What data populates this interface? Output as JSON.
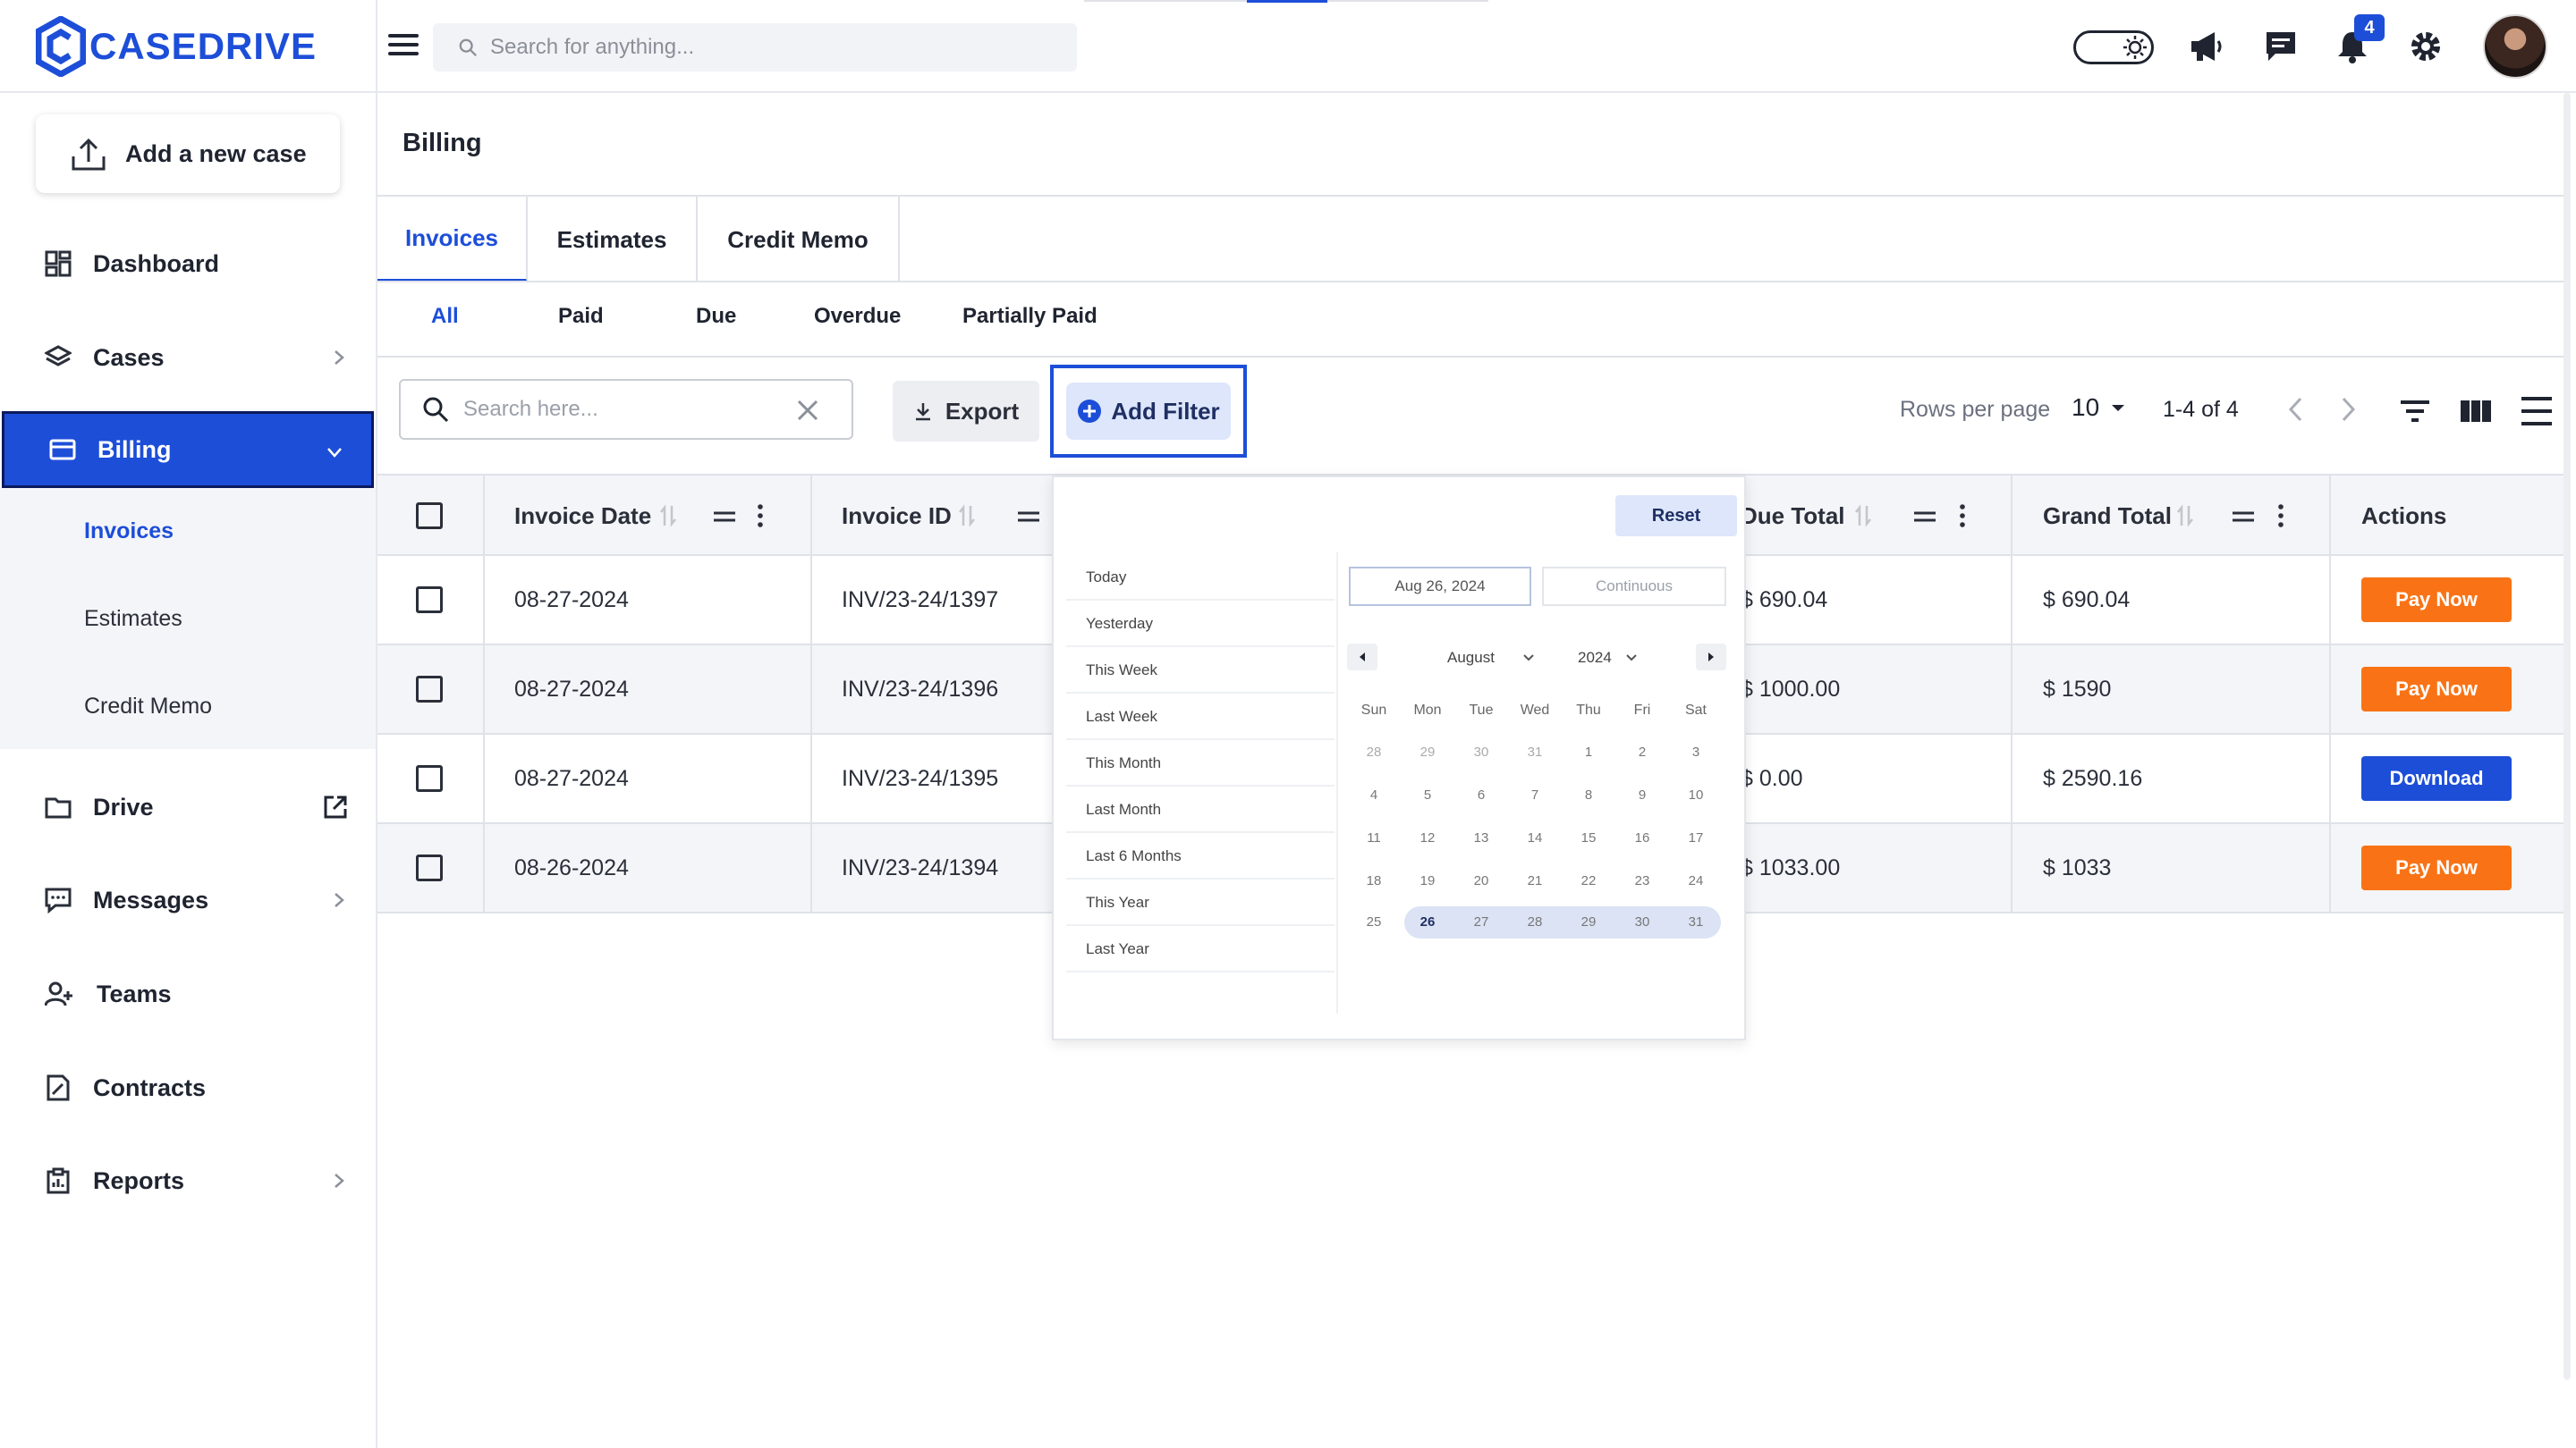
{
  "app": {
    "brand": "CASEDRIVE",
    "search_placeholder": "Search for anything...",
    "notification_count": "4",
    "colors": {
      "accent": "#1d4ed8",
      "pay": "#f97316",
      "download": "#1d4ed8"
    }
  },
  "sidebar": {
    "new_case_label": "Add a new case",
    "items": [
      {
        "label": "Dashboard",
        "icon": "dashboard-icon"
      },
      {
        "label": "Cases",
        "icon": "layers-icon"
      },
      {
        "label": "Billing",
        "icon": "card-icon"
      },
      {
        "label": "Drive",
        "icon": "folder-icon"
      },
      {
        "label": "Messages",
        "icon": "message-icon"
      },
      {
        "label": "Teams",
        "icon": "team-icon"
      },
      {
        "label": "Contracts",
        "icon": "contract-icon"
      },
      {
        "label": "Reports",
        "icon": "report-icon"
      }
    ],
    "billing_sub": [
      "Invoices",
      "Estimates",
      "Credit Memo"
    ]
  },
  "page": {
    "title": "Billing",
    "tabs": [
      "Invoices",
      "Estimates",
      "Credit Memo"
    ],
    "subtabs": [
      "All",
      "Paid",
      "Due",
      "Overdue",
      "Partially Paid"
    ]
  },
  "toolbar": {
    "search_placeholder": "Search here...",
    "export_label": "Export",
    "add_filter_label": "Add Filter",
    "rows_per_page_label": "Rows per page",
    "rows_per_page_value": "10",
    "range_label": "1-4 of 4"
  },
  "table": {
    "columns": [
      "Invoice Date",
      "Invoice ID",
      "Due Total",
      "Grand Total",
      "Actions"
    ],
    "rows": [
      {
        "date": "08-27-2024",
        "id": "INV/23-24/1397",
        "due": "$ 690.04",
        "grand": "$ 690.04",
        "action": "Pay Now"
      },
      {
        "date": "08-27-2024",
        "id": "INV/23-24/1396",
        "due": "$ 1000.00",
        "grand": "$ 1590",
        "action": "Pay Now"
      },
      {
        "date": "08-27-2024",
        "id": "INV/23-24/1395",
        "due": "$ 0.00",
        "grand": "$ 2590.16",
        "action": "Download"
      },
      {
        "date": "08-26-2024",
        "id": "INV/23-24/1394",
        "due": "$ 1033.00",
        "grand": "$ 1033",
        "action": "Pay Now"
      }
    ]
  },
  "datepicker": {
    "reset_label": "Reset",
    "presets": [
      "Today",
      "Yesterday",
      "This Week",
      "Last Week",
      "This Month",
      "Last Month",
      "Last 6 Months",
      "This Year",
      "Last Year"
    ],
    "start_date": "Aug 26, 2024",
    "end_date": "Continuous",
    "month": "August",
    "year": "2024",
    "weekdays": [
      "Sun",
      "Mon",
      "Tue",
      "Wed",
      "Thu",
      "Fri",
      "Sat"
    ],
    "weeks": [
      [
        "28",
        "29",
        "30",
        "31",
        "1",
        "2",
        "3"
      ],
      [
        "4",
        "5",
        "6",
        "7",
        "8",
        "9",
        "10"
      ],
      [
        "11",
        "12",
        "13",
        "14",
        "15",
        "16",
        "17"
      ],
      [
        "18",
        "19",
        "20",
        "21",
        "22",
        "23",
        "24"
      ],
      [
        "25",
        "26",
        "27",
        "28",
        "29",
        "30",
        "31"
      ]
    ]
  }
}
